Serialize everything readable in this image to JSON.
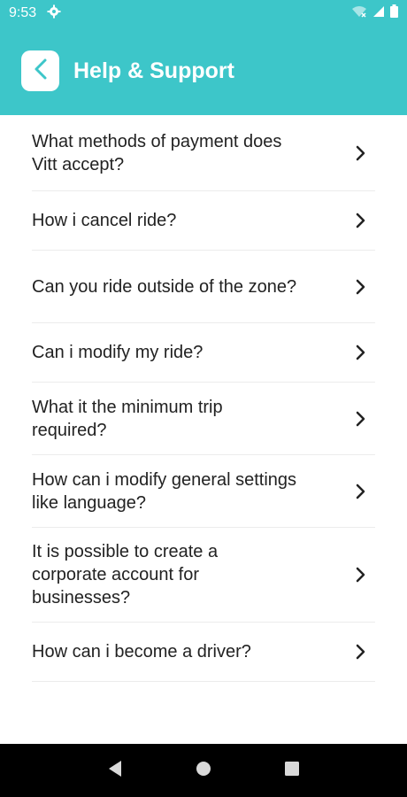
{
  "status_bar": {
    "time": "9:53"
  },
  "header": {
    "title": "Help & Support"
  },
  "faq": [
    {
      "question": "What methods of payment does Vitt accept?"
    },
    {
      "question": "How i cancel ride?"
    },
    {
      "question": "Can you ride outside of the zone?"
    },
    {
      "question": "Can i modify my ride?"
    },
    {
      "question": "What it the minimum trip required?"
    },
    {
      "question": "How can i modify general settings like language?"
    },
    {
      "question": "It is possible to create a corporate account for businesses?"
    },
    {
      "question": "How can i become a driver?"
    }
  ],
  "colors": {
    "accent": "#3dc6c9",
    "text": "#222222",
    "nav_bar": "#000000"
  },
  "icons": [
    "settings-gear-icon",
    "wifi-icon",
    "signal-icon",
    "battery-icon",
    "chevron-left-icon",
    "chevron-right-icon",
    "nav-back-icon",
    "nav-home-icon",
    "nav-recents-icon"
  ]
}
